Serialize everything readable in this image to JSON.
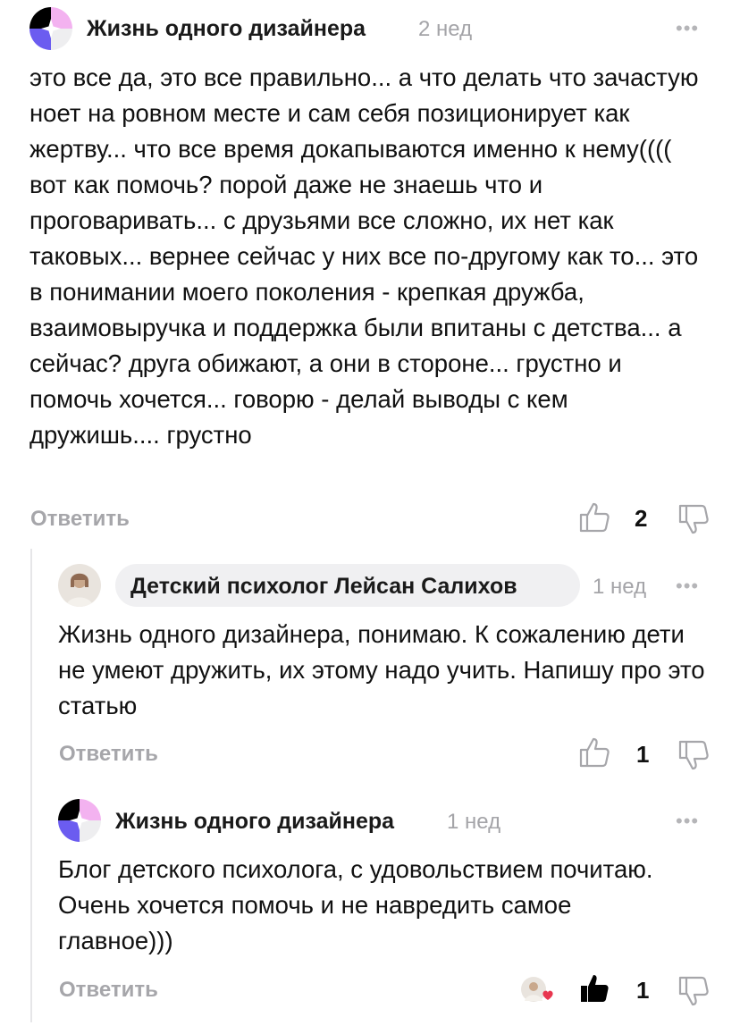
{
  "comments": [
    {
      "author": "Жизнь одного дизайнера",
      "time": "2 нед",
      "more": "•••",
      "text": "это все да, это все правильно... а что делать что зачастую ноет на ровном месте и сам себя позиционирует как жертву... что все время докапываются именно к нему(((( вот как помочь? порой даже не знаешь что и проговаривать... с друзьями все сложно, их нет как таковых... вернее сейчас у них все по-другому как то... это в понимании моего поколения - крепкая дружба, взаимовыручка и поддержка были впитаны с детства... а сейчас? друга обижают, а они в стороне... грустно и помочь хочется... говорю - делай выводы с кем дружишь.... грустно",
      "reply_label": "Ответить",
      "likes": "2"
    },
    {
      "author": "Детский психолог Лейсан Салихов",
      "time": "1 нед",
      "more": "•••",
      "text": "Жизнь одного дизайнера, понимаю. К сожалению дети не умеют дружить, их этому надо учить. Напишу про это статью",
      "reply_label": "Ответить",
      "likes": "1"
    },
    {
      "author": "Жизнь одного дизайнера",
      "time": "1 нед",
      "more": "•••",
      "text": "Блог детского психолога, с удовольствием почитаю. Очень хочется помочь и не навредить самое главное)))",
      "reply_label": "Ответить",
      "likes": "1"
    }
  ],
  "colors": {
    "avatar_pink": "#f3b2f0",
    "avatar_purple": "#6b5cf0",
    "text_muted": "#a6a6aa",
    "thread_line": "#e6e6e8"
  }
}
